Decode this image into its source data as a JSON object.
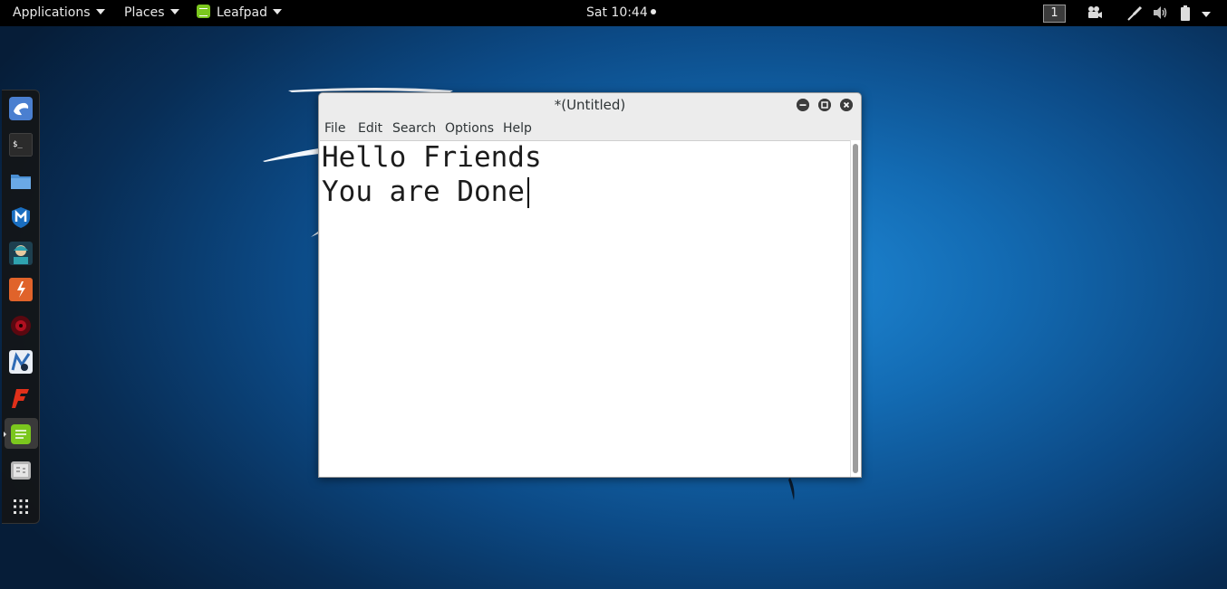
{
  "topbar": {
    "applications_label": "Applications",
    "places_label": "Places",
    "app_label": "Leafpad",
    "clock": "Sat 10:44",
    "workspace": "1"
  },
  "dock": {
    "items": [
      {
        "icon": "kali-dragon-icon",
        "color": "#4a7fd0"
      },
      {
        "icon": "terminal-icon",
        "color": "#2b2b2b"
      },
      {
        "icon": "folder-icon",
        "color": "#4a8fd4"
      },
      {
        "icon": "metasploit-icon",
        "color": "#1a6ec0"
      },
      {
        "icon": "armitage-icon",
        "color": "#2fa3b0"
      },
      {
        "icon": "burpsuite-icon",
        "color": "#e0632a"
      },
      {
        "icon": "beef-icon",
        "color": "#b01020"
      },
      {
        "icon": "maltego-icon",
        "color": "#2e6bb5"
      },
      {
        "icon": "faraday-icon",
        "color": "#e0301a"
      },
      {
        "icon": "leafpad-icon",
        "color": "#7bc71e"
      },
      {
        "icon": "cherrytree-icon",
        "color": "#9a9a9a"
      },
      {
        "icon": "show-apps-grid-icon",
        "color": "#e0e0e0"
      }
    ]
  },
  "window": {
    "title": "*(Untitled)",
    "menu": [
      "File",
      "Edit",
      "Search",
      "Options",
      "Help"
    ],
    "lines": [
      "Hello Friends",
      "You are Done"
    ]
  },
  "colors": {
    "topbar_bg": "#000000",
    "editor_bg": "#ffffff",
    "leafpad_green": "#7bc71e"
  }
}
